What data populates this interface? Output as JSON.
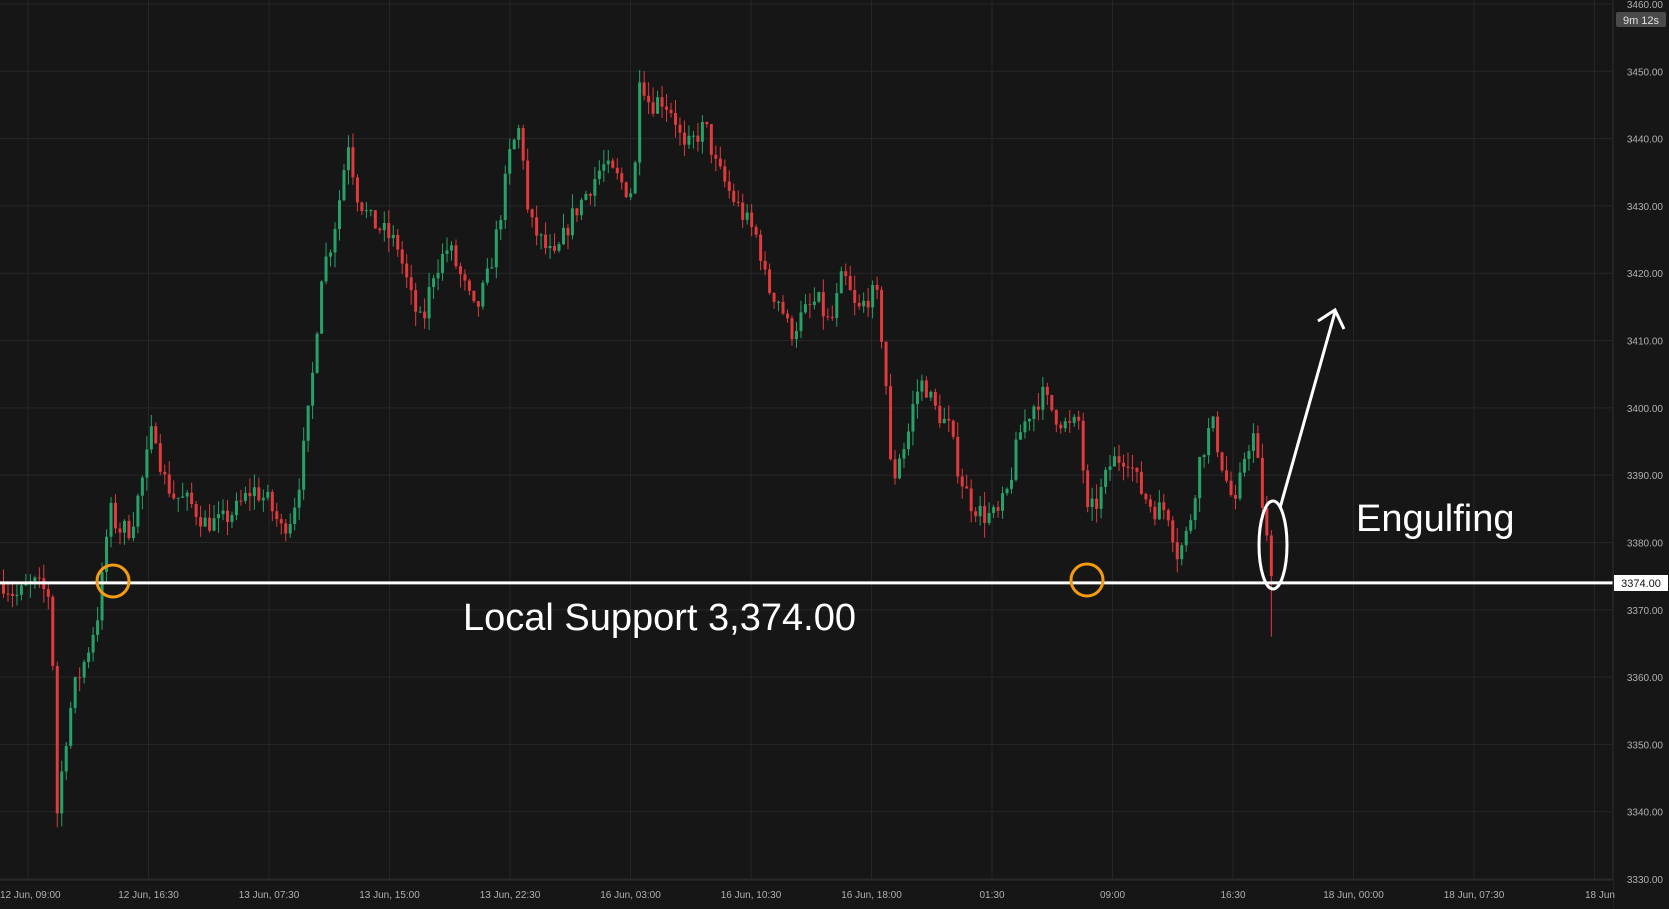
{
  "chart_data": {
    "type": "candlestick",
    "instrument_timer": "9m 12s",
    "current_price_label": "3374.00",
    "y_ticks": [
      "3460.00",
      "3450.00",
      "3440.00",
      "3430.00",
      "3420.00",
      "3410.00",
      "3400.00",
      "3390.00",
      "3380.00",
      "3370.00",
      "3360.00",
      "3350.00",
      "3340.00",
      "3330.00"
    ],
    "ylim": [
      3330,
      3460
    ],
    "x_ticks": [
      "12 Jun, 09:00",
      "12 Jun, 16:30",
      "13 Jun, 07:30",
      "13 Jun, 15:00",
      "13 Jun, 22:30",
      "16 Jun, 03:00",
      "16 Jun, 10:30",
      "16 Jun, 18:00",
      "01:30",
      "09:00",
      "16:30",
      "18 Jun, 00:00",
      "18 Jun, 07:30",
      "18 Jun"
    ],
    "support_level": 3374,
    "annotations": {
      "support_label": "Local Support 3,374.00",
      "pattern_label": "Engulfing"
    },
    "colors": {
      "background": "#161616",
      "up": "#26a269",
      "down": "#e0393e",
      "grid": "#262626",
      "support_line": "#ffffff",
      "touch_circle": "#f39c12",
      "axis_text": "#b0b0b0"
    },
    "price_path": [
      [
        0,
        3374
      ],
      [
        0.012,
        3372
      ],
      [
        0.028,
        3374
      ],
      [
        0.045,
        3372
      ],
      [
        0.05,
        3339
      ],
      [
        0.058,
        3350
      ],
      [
        0.066,
        3358
      ],
      [
        0.078,
        3363
      ],
      [
        0.09,
        3370
      ],
      [
        0.1,
        3385
      ],
      [
        0.108,
        3382
      ],
      [
        0.12,
        3382
      ],
      [
        0.132,
        3390
      ],
      [
        0.142,
        3398
      ],
      [
        0.15,
        3390
      ],
      [
        0.16,
        3387
      ],
      [
        0.175,
        3386
      ],
      [
        0.19,
        3383
      ],
      [
        0.205,
        3383
      ],
      [
        0.22,
        3385
      ],
      [
        0.235,
        3388
      ],
      [
        0.25,
        3386
      ],
      [
        0.262,
        3382
      ],
      [
        0.272,
        3384
      ],
      [
        0.28,
        3390
      ],
      [
        0.29,
        3402
      ],
      [
        0.3,
        3420
      ],
      [
        0.31,
        3425
      ],
      [
        0.318,
        3432
      ],
      [
        0.325,
        3440
      ],
      [
        0.333,
        3432
      ],
      [
        0.345,
        3428
      ],
      [
        0.36,
        3426
      ],
      [
        0.372,
        3424
      ],
      [
        0.385,
        3416
      ],
      [
        0.395,
        3412
      ],
      [
        0.405,
        3420
      ],
      [
        0.42,
        3424
      ],
      [
        0.435,
        3418
      ],
      [
        0.445,
        3414
      ],
      [
        0.458,
        3420
      ],
      [
        0.468,
        3428
      ],
      [
        0.478,
        3438
      ],
      [
        0.488,
        3442
      ],
      [
        0.495,
        3428
      ],
      [
        0.51,
        3424
      ],
      [
        0.52,
        3422
      ],
      [
        0.535,
        3428
      ],
      [
        0.55,
        3432
      ],
      [
        0.565,
        3436
      ],
      [
        0.58,
        3434
      ],
      [
        0.59,
        3432
      ],
      [
        0.595,
        3433
      ],
      [
        0.6,
        3450
      ],
      [
        0.61,
        3445
      ],
      [
        0.62,
        3446
      ],
      [
        0.632,
        3444
      ],
      [
        0.642,
        3438
      ],
      [
        0.652,
        3440
      ],
      [
        0.662,
        3442
      ],
      [
        0.672,
        3436
      ],
      [
        0.685,
        3432
      ],
      [
        0.7,
        3428
      ],
      [
        0.712,
        3425
      ],
      [
        0.72,
        3418
      ],
      [
        0.732,
        3416
      ],
      [
        0.742,
        3411
      ],
      [
        0.755,
        3414
      ],
      [
        0.768,
        3416
      ],
      [
        0.78,
        3412
      ],
      [
        0.792,
        3420
      ],
      [
        0.805,
        3414
      ],
      [
        0.818,
        3417
      ],
      [
        0.825,
        3416
      ],
      [
        0.832,
        3405
      ],
      [
        0.838,
        3388
      ],
      [
        0.845,
        3393
      ],
      [
        0.852,
        3395
      ],
      [
        0.86,
        3402
      ],
      [
        0.868,
        3404
      ],
      [
        0.878,
        3400
      ],
      [
        0.892,
        3397
      ],
      [
        0.902,
        3390
      ],
      [
        0.912,
        3386
      ],
      [
        0.925,
        3384
      ],
      [
        0.938,
        3384
      ],
      [
        0.948,
        3388
      ],
      [
        0.958,
        3396
      ],
      [
        0.97,
        3400
      ],
      [
        0.98,
        3402
      ],
      [
        0.992,
        3399
      ],
      [
        1.005,
        3397
      ],
      [
        1.015,
        3398
      ],
      [
        1.022,
        3384
      ],
      [
        1.032,
        3386
      ],
      [
        1.045,
        3392
      ],
      [
        1.06,
        3393
      ],
      [
        1.072,
        3388
      ],
      [
        1.085,
        3385
      ],
      [
        1.098,
        3385
      ],
      [
        1.108,
        3378
      ],
      [
        1.118,
        3382
      ],
      [
        1.128,
        3392
      ],
      [
        1.14,
        3398
      ],
      [
        1.152,
        3390
      ],
      [
        1.162,
        3385
      ],
      [
        1.172,
        3394
      ],
      [
        1.18,
        3396
      ],
      [
        1.188,
        3385
      ],
      [
        1.196,
        3375
      ]
    ]
  }
}
